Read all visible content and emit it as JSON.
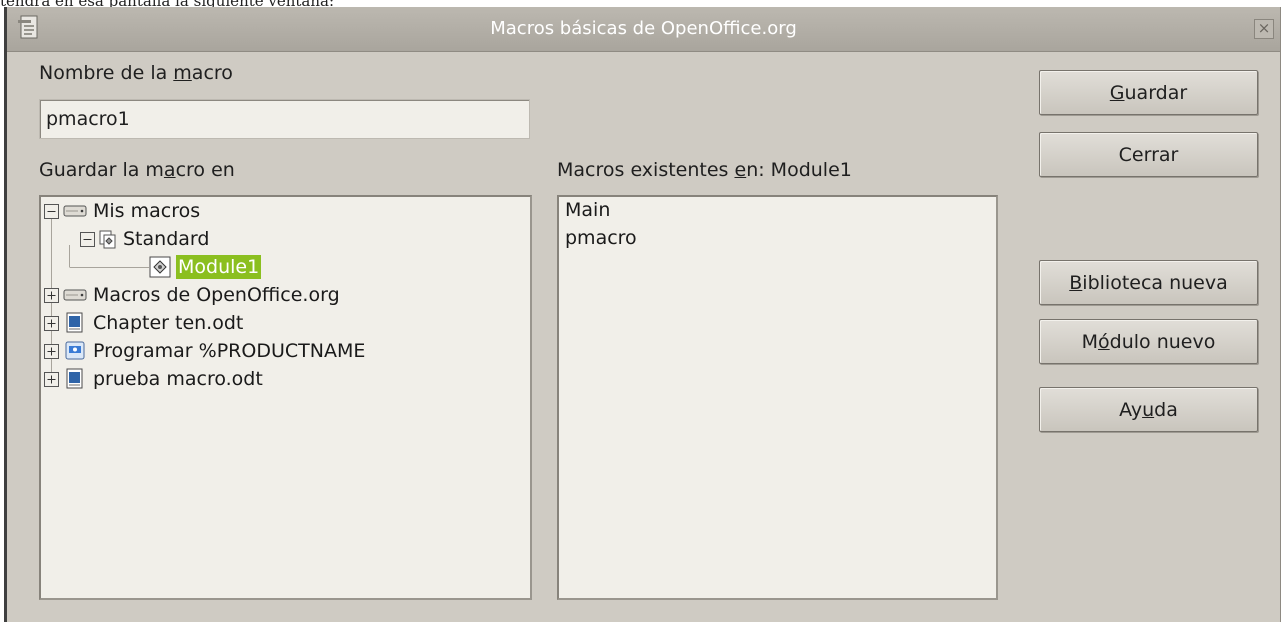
{
  "page_caption": "tendrá en esa pantalla la siguiente ventana:",
  "window": {
    "title": "Macros básicas de OpenOffice.org",
    "close_glyph": "×"
  },
  "macro_name": {
    "label_pre": "Nombre de la ",
    "label_key": "m",
    "label_post": "acro",
    "value": "pmacro1"
  },
  "save_in": {
    "label_pre": "Guardar la m",
    "label_key": "a",
    "label_post": "cro en"
  },
  "tree": [
    {
      "label": "Mis macros",
      "expander": "minus",
      "icon": "drive-icon"
    },
    {
      "label": "Standard",
      "expander": "minus",
      "icon": "library-icon"
    },
    {
      "label": "Module1",
      "expander": "none",
      "icon": "module-icon",
      "selected": true
    },
    {
      "label": "Macros de OpenOffice.org",
      "expander": "plus",
      "icon": "drive-icon"
    },
    {
      "label": "Chapter ten.odt",
      "expander": "plus",
      "icon": "document-icon"
    },
    {
      "label": "Programar %PRODUCTNAME",
      "expander": "plus",
      "icon": "presentation-icon"
    },
    {
      "label": "prueba macro.odt",
      "expander": "plus",
      "icon": "document-icon"
    }
  ],
  "existing": {
    "label_pre": "Macros existentes ",
    "label_key": "e",
    "label_post": "n: Module1",
    "items": [
      "Main",
      "pmacro"
    ]
  },
  "buttons": {
    "save": {
      "key": "G",
      "rest": "uardar"
    },
    "close": {
      "label": "Cerrar"
    },
    "new_library": {
      "key": "B",
      "rest": "iblioteca nueva"
    },
    "new_module": {
      "pre": "M",
      "key": "ó",
      "rest": "dulo nuevo"
    },
    "help": {
      "pre": "Ay",
      "key": "u",
      "rest": "da"
    }
  },
  "colors": {
    "selection": "#8bbf1f",
    "dialog_bg": "#cfcbc3",
    "field_bg": "#f1efe9"
  }
}
